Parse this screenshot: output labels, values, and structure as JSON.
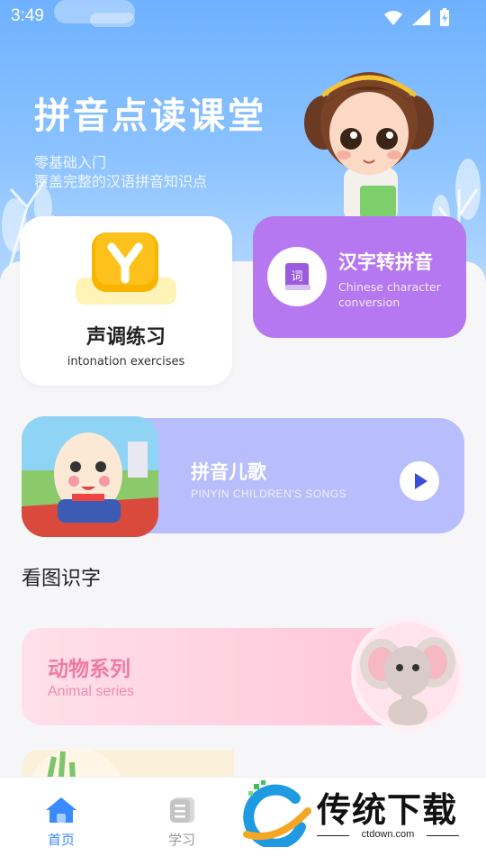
{
  "status": {
    "time": "3:49",
    "wifi_icon": "wifi-icon",
    "signal_icon": "signal-icon",
    "battery_icon": "battery-charging-icon"
  },
  "hero": {
    "title": "拼音点读课堂",
    "subtitle_line1": "零基础入门",
    "subtitle_line2": "覆盖完整的汉语拼音知识点"
  },
  "cards": {
    "tone": {
      "title": "声调练习",
      "subtitle": "intonation exercises",
      "icon": "y-letter-icon"
    },
    "convert": {
      "title": "汉字转拼音",
      "subtitle": "Chinese character conversion",
      "icon": "book-icon",
      "icon_text": "词"
    },
    "song": {
      "title": "拼音儿歌",
      "subtitle": "PINYIN CHILDREN'S SONGS",
      "play_icon": "play-icon"
    }
  },
  "section": {
    "title": "看图识字"
  },
  "animal": {
    "title": "动物系列",
    "subtitle": "Animal series"
  },
  "tabbar": {
    "home": {
      "label": "首页",
      "icon": "home-icon"
    },
    "study": {
      "label": "学习",
      "icon": "notebook-icon"
    }
  },
  "watermark": {
    "text": "传统下载",
    "url": "ctdown.com"
  },
  "colors": {
    "accent": "#3a8bff",
    "purple": "#b678f0",
    "lavender": "#b8bdfb",
    "pink": "#f07aa0"
  }
}
